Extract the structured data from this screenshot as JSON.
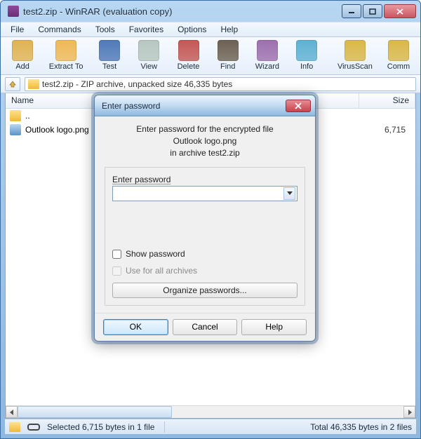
{
  "window": {
    "title": "test2.zip - WinRAR (evaluation copy)"
  },
  "menu": [
    "File",
    "Commands",
    "Tools",
    "Favorites",
    "Options",
    "Help"
  ],
  "toolbar": [
    {
      "label": "Add",
      "color": "#e0b352"
    },
    {
      "label": "Extract To",
      "color": "#efb955"
    },
    {
      "label": "Test",
      "color": "#4f79b8"
    },
    {
      "label": "View",
      "color": "#b7c7c0"
    },
    {
      "label": "Delete",
      "color": "#c45755"
    },
    {
      "label": "Find",
      "color": "#6c6052"
    },
    {
      "label": "Wizard",
      "color": "#9d6fae"
    },
    {
      "label": "Info",
      "color": "#5db1d2"
    },
    {
      "label": "VirusScan",
      "color": "#d9b848"
    },
    {
      "label": "Comm",
      "color": "#d9b848"
    }
  ],
  "address": {
    "path": "test2.zip - ZIP archive, unpacked size 46,335 bytes"
  },
  "columns": {
    "name": "Name",
    "size": "Size"
  },
  "rows": [
    {
      "type": "folder",
      "name": "..",
      "size": ""
    },
    {
      "type": "img",
      "name": "Outlook logo.png",
      "size": "6,715"
    }
  ],
  "status": {
    "selected": "Selected 6,715 bytes in 1 file",
    "total": "Total 46,335 bytes in 2 files"
  },
  "dialog": {
    "title": "Enter password",
    "msg_line1": "Enter password for the encrypted file",
    "msg_line2": "Outlook logo.png",
    "msg_line3": "in archive test2.zip",
    "password_label": "Enter password",
    "show_password": "Show password",
    "use_all": "Use for all archives",
    "organize": "Organize passwords...",
    "ok": "OK",
    "cancel": "Cancel",
    "help": "Help"
  }
}
